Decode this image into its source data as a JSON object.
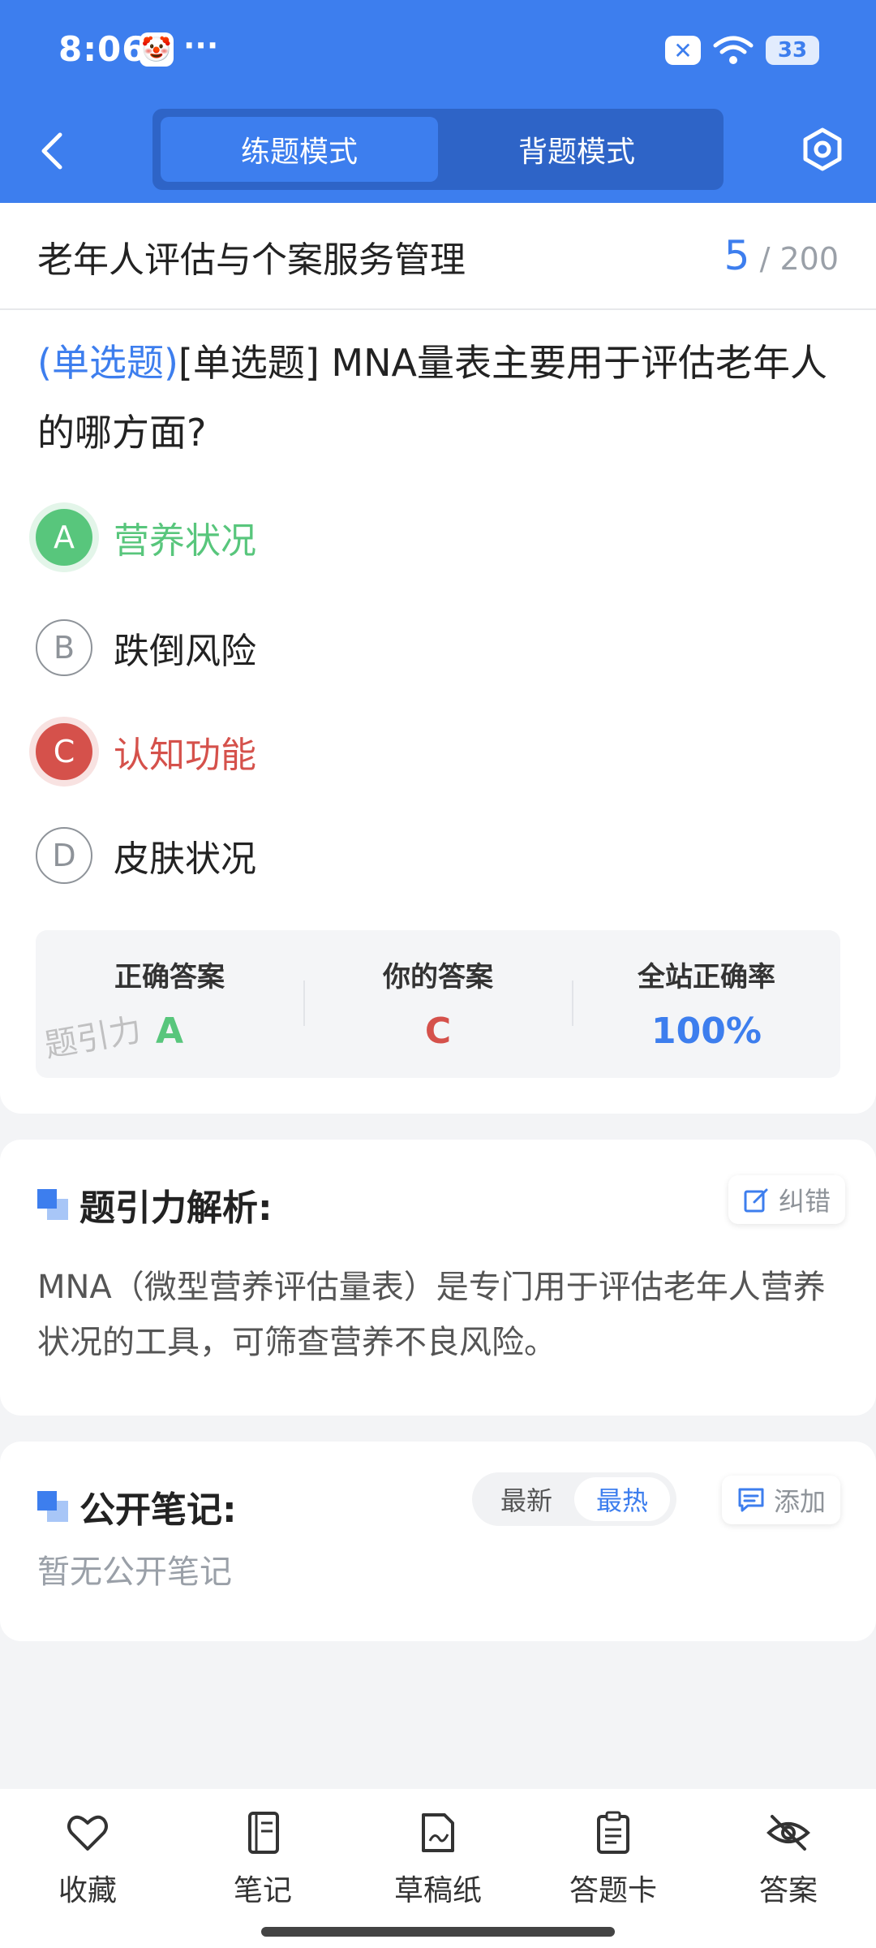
{
  "status_bar": {
    "time": "8:06",
    "dots": "···",
    "battery": "33"
  },
  "header": {
    "modes": [
      "练题模式",
      "背题模式"
    ],
    "active_mode": "练题模式"
  },
  "course": {
    "title": "老年人评估与个案服务管理",
    "current": "5",
    "total": "/ 200"
  },
  "question": {
    "type_label": "(单选题)",
    "text": "[单选题] MNA量表主要用于评估老年人的哪方面?",
    "options": [
      {
        "letter": "A",
        "text": "营养状况",
        "state": "correct"
      },
      {
        "letter": "B",
        "text": "跌倒风险",
        "state": "normal"
      },
      {
        "letter": "C",
        "text": "认知功能",
        "state": "wrong"
      },
      {
        "letter": "D",
        "text": "皮肤状况",
        "state": "normal"
      }
    ]
  },
  "stats": {
    "correct_label": "正确答案",
    "correct_value": "A",
    "yours_label": "你的答案",
    "yours_value": "C",
    "rate_label": "全站正确率",
    "rate_value": "100%",
    "watermark": "题引力"
  },
  "analysis": {
    "title": "题引力解析:",
    "correct_button": "纠错",
    "text": "MNA（微型营养评估量表）是专门用于评估老年人营养状况的工具，可筛查营养不良风险。"
  },
  "notes": {
    "title": "公开笔记:",
    "sort_options": [
      "最新",
      "最热"
    ],
    "active_sort": "最热",
    "add_button": "添加",
    "empty_text": "暂无公开笔记"
  },
  "bottom_nav": [
    {
      "label": "收藏",
      "icon": "heart-icon"
    },
    {
      "label": "笔记",
      "icon": "notebook-icon"
    },
    {
      "label": "草稿纸",
      "icon": "draft-paper-icon"
    },
    {
      "label": "答题卡",
      "icon": "answer-sheet-icon"
    },
    {
      "label": "答案",
      "icon": "eye-off-icon"
    }
  ],
  "colors": {
    "primary": "#3d7eee",
    "correct": "#58c67c",
    "wrong": "#d5514b"
  }
}
